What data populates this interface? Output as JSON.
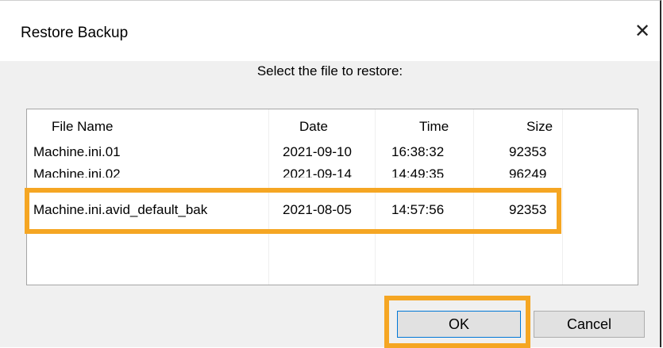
{
  "dialog": {
    "title": "Restore Backup",
    "prompt": "Select the file to restore:",
    "close_glyph": "✕"
  },
  "table": {
    "columns": [
      "File Name",
      "Date",
      "Time",
      "Size"
    ],
    "rows": [
      {
        "name": "Machine.ini.01",
        "date": "2021-09-10",
        "time": "16:38:32",
        "size": "92353"
      },
      {
        "name": "Machine.ini.02",
        "date": "2021-09-14",
        "time": "14:49:35",
        "size": "96249"
      },
      {
        "name": "Machine.ini.avid_default_bak",
        "date": "2021-08-05",
        "time": "14:57:56",
        "size": "92353"
      }
    ]
  },
  "buttons": {
    "ok": "OK",
    "cancel": "Cancel"
  },
  "colors": {
    "highlight": "#f5a623",
    "dialog_bg": "#f0f0f0"
  }
}
